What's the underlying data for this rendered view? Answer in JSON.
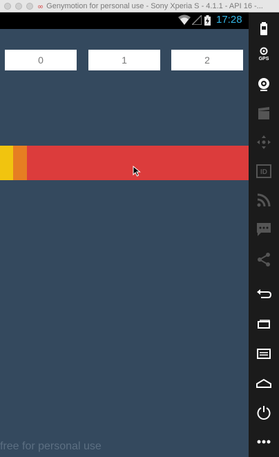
{
  "window": {
    "title": "Genymotion for personal use - Sony Xperia S - 4.1.1 - API 16 -..."
  },
  "statusbar": {
    "time": "17:28"
  },
  "buttons": [
    {
      "label": "0"
    },
    {
      "label": "1"
    },
    {
      "label": "2"
    }
  ],
  "progress_bar": {
    "segments": [
      {
        "color": "#f1c40f",
        "fraction": 0.053
      },
      {
        "color": "#e67e22",
        "fraction": 0.055
      },
      {
        "color": "#dc3c3c",
        "fraction": 0.892
      }
    ]
  },
  "watermark": "free for personal use",
  "toolbar": {
    "gps_label": "GPS",
    "icons": [
      "battery-icon",
      "gps-icon",
      "webcam-icon",
      "capture-icon",
      "dpad-icon",
      "id-icon",
      "rss-icon",
      "sms-icon",
      "share-icon",
      "back-icon",
      "recent-apps-icon",
      "menu-icon",
      "home-icon",
      "power-icon",
      "more-icon"
    ]
  }
}
